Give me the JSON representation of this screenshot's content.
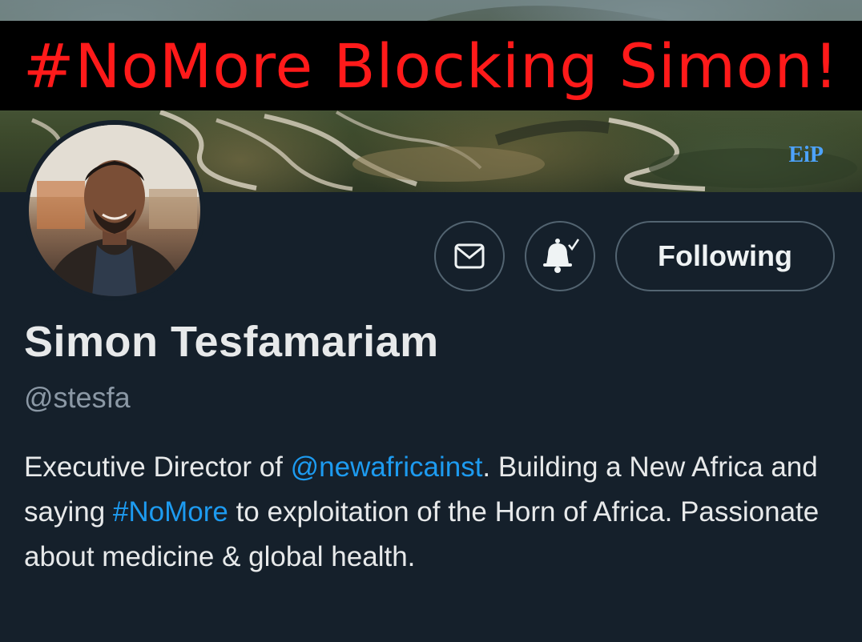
{
  "banner": {
    "headline": "#NoMore Blocking Simon!",
    "logo_text": "EiP",
    "colors": {
      "headline": "#ff1a1a",
      "logo": "#4da3ff"
    }
  },
  "profile": {
    "display_name": "Simon Tesfamariam",
    "handle": "@stesfa",
    "bio": {
      "part1": "Executive Director of ",
      "mention": "@newafricainst",
      "part2": ". Building a New Africa and saying ",
      "hashtag": "#NoMore",
      "part3": " to exploitation of the Horn of Africa. Passionate about medicine & global health."
    }
  },
  "actions": {
    "message_icon": "envelope-icon",
    "notify_icon": "bell-check-icon",
    "following_label": "Following"
  },
  "colors": {
    "background": "#15202b",
    "text_primary": "#e7e9ea",
    "text_secondary": "#8b98a5",
    "link": "#1d9bf0",
    "border": "#536471"
  }
}
